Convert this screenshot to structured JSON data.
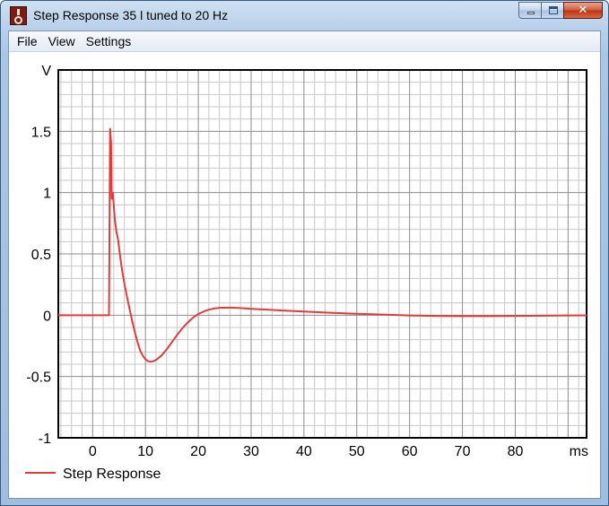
{
  "window": {
    "title": "Step Response 35 l tuned to 20 Hz"
  },
  "icons": {
    "app": "speaker-app-icon",
    "minimize": "minimize-icon",
    "maximize": "maximize-icon",
    "close": "close-icon",
    "close_glyph": "✕"
  },
  "menu": {
    "items": [
      {
        "label": "File"
      },
      {
        "label": "View"
      },
      {
        "label": "Settings"
      }
    ]
  },
  "chart_data": {
    "type": "line",
    "title": "",
    "xlabel": "ms",
    "ylabel": "V",
    "xlim": [
      -6.5,
      93.5
    ],
    "ylim": [
      -1,
      2
    ],
    "x_ticks": [
      0,
      10,
      20,
      30,
      40,
      50,
      60,
      70,
      80
    ],
    "y_ticks": [
      -1,
      -0.5,
      0,
      0.5,
      1,
      1.5
    ],
    "y_tick_labels": [
      "-1",
      "-0.5",
      "0",
      "0.5",
      "1",
      "1.5"
    ],
    "x_tick_labels": [
      "0",
      "10",
      "20",
      "30",
      "40",
      "50",
      "60",
      "70",
      "80"
    ],
    "grid": true,
    "legend_placement": "bottom-left",
    "series": [
      {
        "name": "Step Response",
        "color": "#e03c3c",
        "points": [
          [
            -6.5,
            0
          ],
          [
            3.1,
            0
          ],
          [
            3.1,
            0.02
          ],
          [
            3.3,
            1.52
          ],
          [
            3.5,
            1.4
          ],
          [
            3.6,
            0.95
          ],
          [
            3.8,
            1.0
          ],
          [
            4.0,
            0.9
          ],
          [
            4.2,
            0.78
          ],
          [
            4.5,
            0.68
          ],
          [
            4.8,
            0.62
          ],
          [
            5.2,
            0.48
          ],
          [
            5.6,
            0.36
          ],
          [
            6.0,
            0.26
          ],
          [
            6.5,
            0.15
          ],
          [
            7.0,
            0.05
          ],
          [
            7.5,
            -0.05
          ],
          [
            8.0,
            -0.14
          ],
          [
            8.5,
            -0.22
          ],
          [
            9.0,
            -0.29
          ],
          [
            9.5,
            -0.33
          ],
          [
            10.0,
            -0.36
          ],
          [
            10.5,
            -0.375
          ],
          [
            11.0,
            -0.38
          ],
          [
            11.5,
            -0.375
          ],
          [
            12.0,
            -0.365
          ],
          [
            13.0,
            -0.33
          ],
          [
            14.0,
            -0.28
          ],
          [
            15.0,
            -0.22
          ],
          [
            16.0,
            -0.16
          ],
          [
            17.0,
            -0.105
          ],
          [
            18.0,
            -0.06
          ],
          [
            19.0,
            -0.02
          ],
          [
            20.0,
            0.01
          ],
          [
            21.0,
            0.03
          ],
          [
            22.0,
            0.045
          ],
          [
            23.0,
            0.055
          ],
          [
            24.0,
            0.06
          ],
          [
            26.0,
            0.062
          ],
          [
            28.0,
            0.058
          ],
          [
            30.0,
            0.052
          ],
          [
            33.0,
            0.045
          ],
          [
            36.0,
            0.038
          ],
          [
            40.0,
            0.03
          ],
          [
            45.0,
            0.02
          ],
          [
            50.0,
            0.012
          ],
          [
            55.0,
            0.005
          ],
          [
            60.0,
            -0.002
          ],
          [
            65.0,
            -0.006
          ],
          [
            70.0,
            -0.008
          ],
          [
            75.0,
            -0.008
          ],
          [
            80.0,
            -0.006
          ],
          [
            85.0,
            -0.004
          ],
          [
            90.0,
            -0.002
          ],
          [
            93.5,
            -0.001
          ]
        ]
      }
    ]
  }
}
